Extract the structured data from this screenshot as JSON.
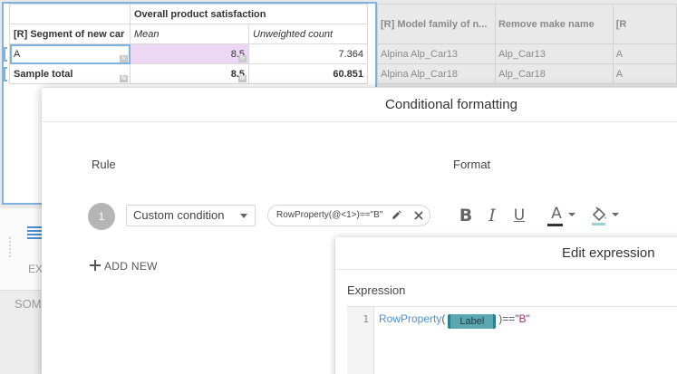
{
  "spreadsheet": {
    "header_group": "Overall product satisfaction",
    "row_header": "[R] Segment of new car",
    "col_mean": "Mean",
    "col_count": "Unweighted count",
    "rows": [
      {
        "label": "A",
        "mean": "8.5",
        "count": "7.364"
      },
      {
        "label": "Sample total",
        "mean": "8.5",
        "count": "60.851"
      }
    ],
    "fx_glyph": "fx",
    "grey_headers": [
      "[R] Model family of n...",
      "Remove make name",
      "[R"
    ],
    "grey_rows": [
      [
        "Alpina Alp_Car13",
        "Alp_Car13",
        "A"
      ],
      [
        "Alpina Alp_Car18",
        "Alp_Car18",
        "A"
      ]
    ]
  },
  "side_panel": {
    "ex_label": "EX",
    "som_label": "SOM"
  },
  "conditional_formatting": {
    "title": "Conditional formatting",
    "rule_label": "Rule",
    "format_label": "Format",
    "rule_number": "1",
    "condition_type": "Custom condition",
    "expression": "RowProperty(@<1>)==\"B\"",
    "add_new_label": "ADD NEW",
    "format_buttons": {
      "bold": "B",
      "italic": "I",
      "underline": "U",
      "font_color": "A"
    },
    "colors": {
      "accent": "#4a90d9",
      "rule_badge": "#b5b5b5"
    }
  },
  "edit_expression": {
    "title": "Edit expression",
    "expression_label": "Expression",
    "line_number": "1",
    "code": {
      "function": "RowProperty",
      "open_paren": "(",
      "token": "Label",
      "close_paren": ")",
      "operator": "==",
      "string": "\"B\""
    }
  }
}
